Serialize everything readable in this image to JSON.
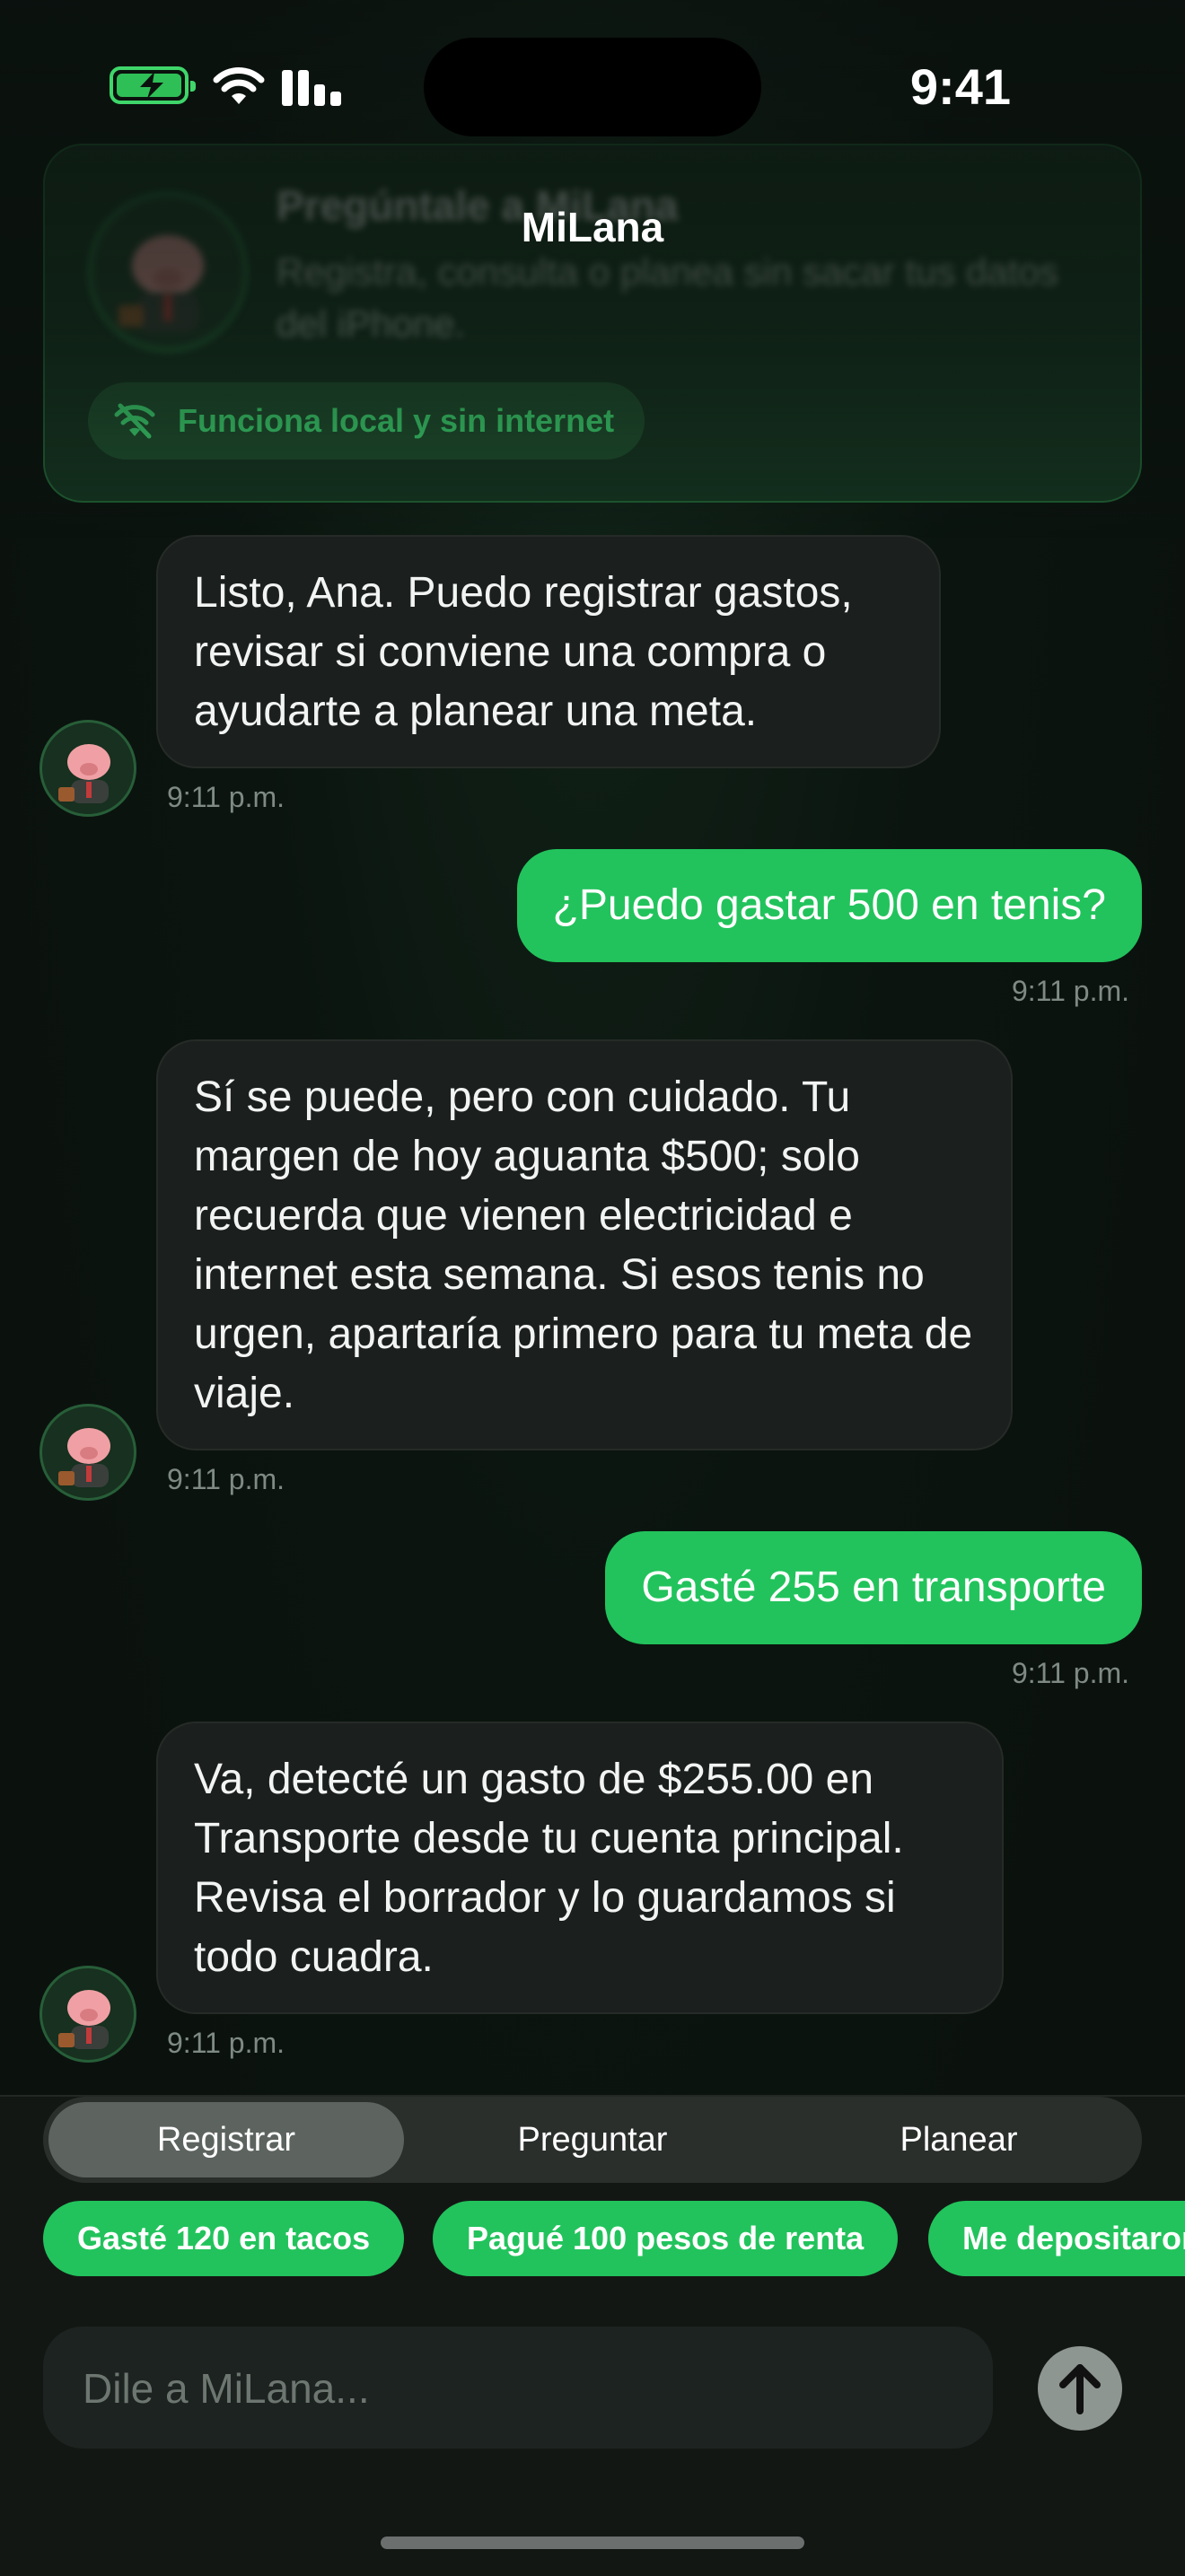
{
  "status_bar": {
    "time": "9:41"
  },
  "nav": {
    "title": "MiLana"
  },
  "hero": {
    "title": "Pregúntale a MiLana",
    "subtitle": "Registra, consulta o planea sin sacar tus datos del iPhone.",
    "chip": "Funciona local y sin internet"
  },
  "messages": [
    {
      "from": "bot",
      "text": "Listo, Ana. Puedo registrar gastos, revisar si conviene una compra o ayudarte a planear una meta.",
      "time": "9:11 p.m."
    },
    {
      "from": "user",
      "text": "¿Puedo gastar 500 en tenis?",
      "time": "9:11 p.m."
    },
    {
      "from": "bot",
      "text": "Sí se puede, pero con cuidado. Tu margen de hoy aguanta $500; solo recuerda que vienen electricidad e internet esta semana. Si esos tenis no urgen, apartaría primero para tu meta de viaje.",
      "time": "9:11 p.m."
    },
    {
      "from": "user",
      "text": "Gasté 255 en transporte",
      "time": "9:11 p.m."
    },
    {
      "from": "bot",
      "text": "Va, detecté un gasto de $255.00 en Transporte desde tu cuenta principal. Revisa el borrador y lo guardamos si todo cuadra.",
      "time": "9:11 p.m."
    }
  ],
  "modes": {
    "selected": "Registrar",
    "items": [
      "Registrar",
      "Preguntar",
      "Planear"
    ]
  },
  "suggestions": [
    "Gasté 120 en tacos",
    "Pagué 100 pesos de renta",
    "Me depositaron"
  ],
  "composer": {
    "placeholder": "Dile a MiLana..."
  },
  "colors": {
    "accent": "#22c35c",
    "bubble_bot": "#1b1f1d",
    "background": "#0b120e"
  }
}
